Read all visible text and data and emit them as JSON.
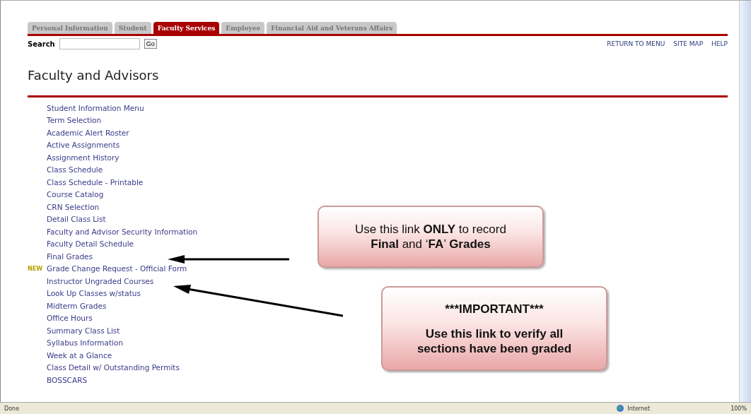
{
  "tabs": [
    {
      "label": "Personal Information",
      "selected": false
    },
    {
      "label": "Student",
      "selected": false
    },
    {
      "label": "Faculty Services",
      "selected": true
    },
    {
      "label": "Employee",
      "selected": false
    },
    {
      "label": "Financial Aid and Veterans Affairs",
      "selected": false
    }
  ],
  "search": {
    "label": "Search",
    "button": "Go"
  },
  "top_links": [
    "RETURN TO MENU",
    "SITE MAP",
    "HELP"
  ],
  "page_title": "Faculty and Advisors",
  "menu": [
    {
      "label": "Student Information Menu"
    },
    {
      "label": "Term Selection"
    },
    {
      "label": "Academic Alert Roster"
    },
    {
      "label": "Active Assignments"
    },
    {
      "label": "Assignment History"
    },
    {
      "label": "Class Schedule"
    },
    {
      "label": "Class Schedule - Printable"
    },
    {
      "label": "Course Catalog"
    },
    {
      "label": "CRN Selection"
    },
    {
      "label": "Detail Class List"
    },
    {
      "label": "Faculty and Advisor Security Information"
    },
    {
      "label": "Faculty Detail Schedule"
    },
    {
      "label": "Final Grades"
    },
    {
      "label": "Grade Change Request - Official Form",
      "badge": "NEW"
    },
    {
      "label": "Instructor Ungraded Courses"
    },
    {
      "label": "Look Up Classes w/status"
    },
    {
      "label": "Midterm Grades"
    },
    {
      "label": "Office Hours"
    },
    {
      "label": "Summary Class List"
    },
    {
      "label": "Syllabus Information"
    },
    {
      "label": "Week at a Glance"
    },
    {
      "label": "Class Detail w/ Outstanding Permits"
    },
    {
      "label": "BOSSCARS"
    }
  ],
  "callouts": [
    {
      "kind": "note",
      "lines": [
        "Use this link **ONLY** to record",
        "**Final** and ‘**FA**’ **Grades**"
      ]
    },
    {
      "kind": "important",
      "lines": [
        "***IMPORTANT***",
        "Use this link to verify all sections have been graded"
      ]
    }
  ],
  "status_bar": {
    "status": "Done",
    "zone": "Internet",
    "zoom": "100%"
  }
}
